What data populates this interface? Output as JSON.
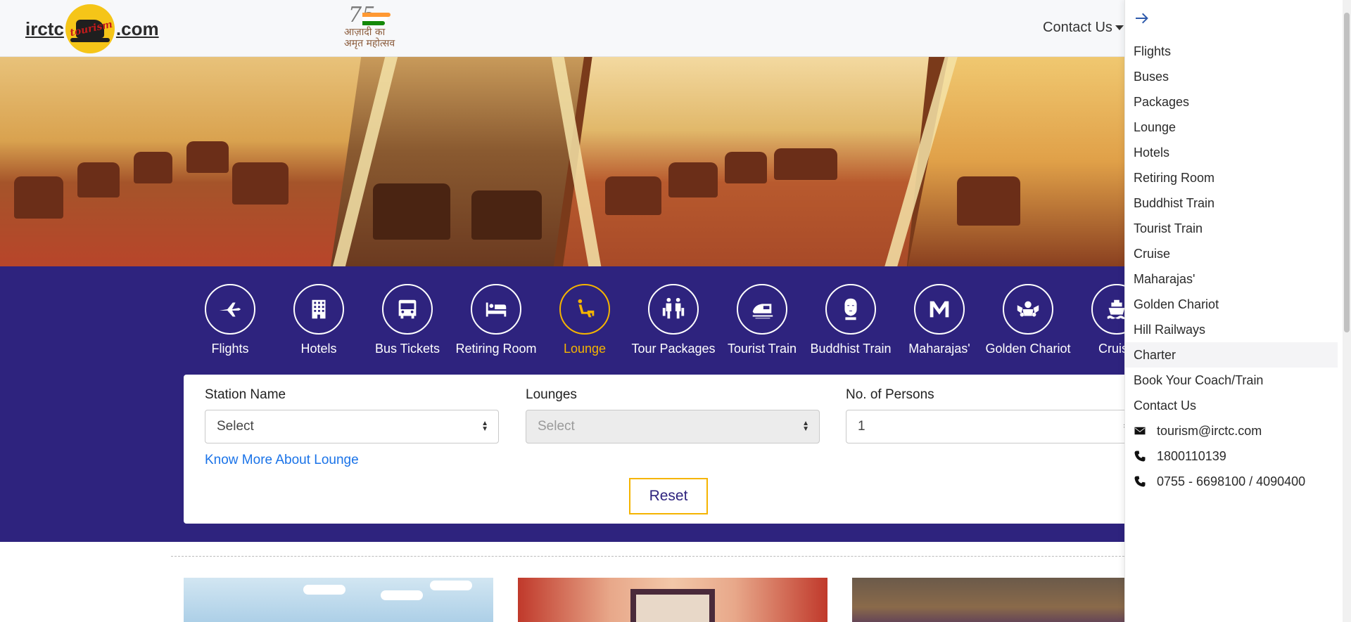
{
  "header": {
    "logo_left": "irctc",
    "logo_right": ".com",
    "logo_script": "tourism",
    "azadi_mark": "75",
    "azadi_line1": "आज़ादी का",
    "azadi_line2": "अमृत महोत्सव",
    "contact_label": "Contact Us"
  },
  "services": [
    {
      "label": "Flights",
      "icon": "plane-icon"
    },
    {
      "label": "Hotels",
      "icon": "building-icon"
    },
    {
      "label": "Bus Tickets",
      "icon": "bus-icon"
    },
    {
      "label": "Retiring Room",
      "icon": "bed-icon"
    },
    {
      "label": "Lounge",
      "icon": "lounge-chair-icon",
      "active": true
    },
    {
      "label": "Tour Packages",
      "icon": "travelers-icon"
    },
    {
      "label": "Tourist Train",
      "icon": "train-icon"
    },
    {
      "label": "Buddhist Train",
      "icon": "buddha-icon"
    },
    {
      "label": "Maharajas'",
      "icon": "maharajas-emblem-icon"
    },
    {
      "label": "Golden Chariot",
      "icon": "chariot-emblem-icon"
    },
    {
      "label": "Cruise",
      "icon": "ship-icon"
    }
  ],
  "form": {
    "station_label": "Station Name",
    "station_value": "Select",
    "lounges_label": "Lounges",
    "lounges_value": "Select",
    "persons_label": "No. of Persons",
    "persons_value": "1",
    "know_more": "Know More About Lounge",
    "reset": "Reset"
  },
  "drawer": {
    "items": [
      "Flights",
      "Buses",
      "Packages",
      "Lounge",
      "Hotels",
      "Retiring Room",
      "Buddhist Train",
      "Tourist Train",
      "Cruise",
      "Maharajas'",
      "Golden Chariot",
      "Hill Railways",
      "Charter",
      "Book Your Coach/Train",
      "Contact Us"
    ],
    "highlighted_item": "Charter",
    "email": "tourism@irctc.com",
    "phone1": "1800110139",
    "phone2": "0755 - 6698100 / 4090400"
  },
  "colors": {
    "band": "#2e237e",
    "accent": "#f5b400",
    "link": "#1a73e8"
  }
}
